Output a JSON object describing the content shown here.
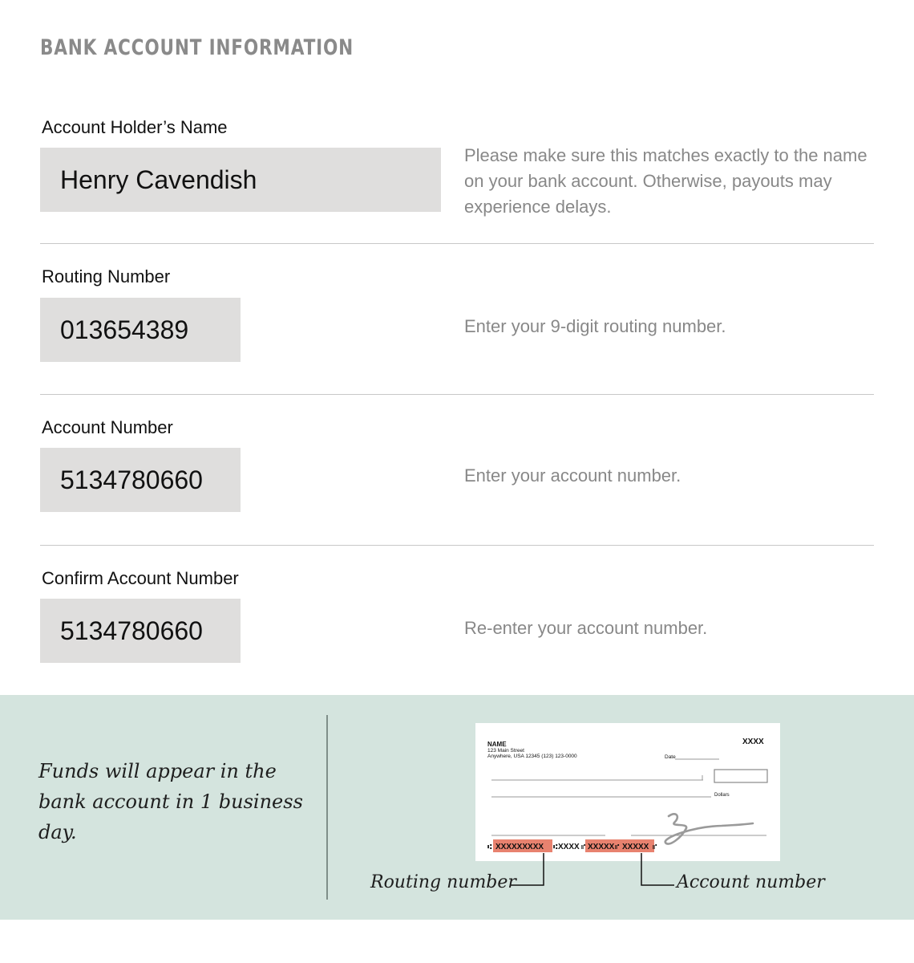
{
  "header": {
    "title": "BANK ACCOUNT INFORMATION"
  },
  "fields": [
    {
      "label": "Account Holder’s Name",
      "value": "Henry Cavendish",
      "hint": "Please make sure this matches exactly to the name on your bank account. Otherwise, payouts may experience delays."
    },
    {
      "label": "Routing Number",
      "value": "013654389",
      "hint": "Enter your 9-digit routing number."
    },
    {
      "label": "Account Number",
      "value": "5134780660",
      "hint": "Enter your account number."
    },
    {
      "label": "Confirm Account Number",
      "value": "5134780660",
      "hint": "Re-enter your account number."
    }
  ],
  "info_panel": {
    "note": "Funds will appear in the bank account in 1 business day.",
    "check": {
      "name": "NAME",
      "address_line1": "123 Main Street",
      "address_line2": "Anywhere, USA 12345 (123) 123-0000",
      "check_number": "XXXX",
      "date_label": "Date",
      "dollars_label": "Dollars",
      "routing_micr": "XXXXXXXXX",
      "middle_micr": "XXXX",
      "account_micr_1": "XXXXX",
      "account_micr_2": "XXXXX"
    },
    "routing_callout": "Routing number",
    "account_callout": "Account number",
    "colors": {
      "panel_bg": "#d4e4de",
      "highlight": "#e8826f"
    }
  }
}
